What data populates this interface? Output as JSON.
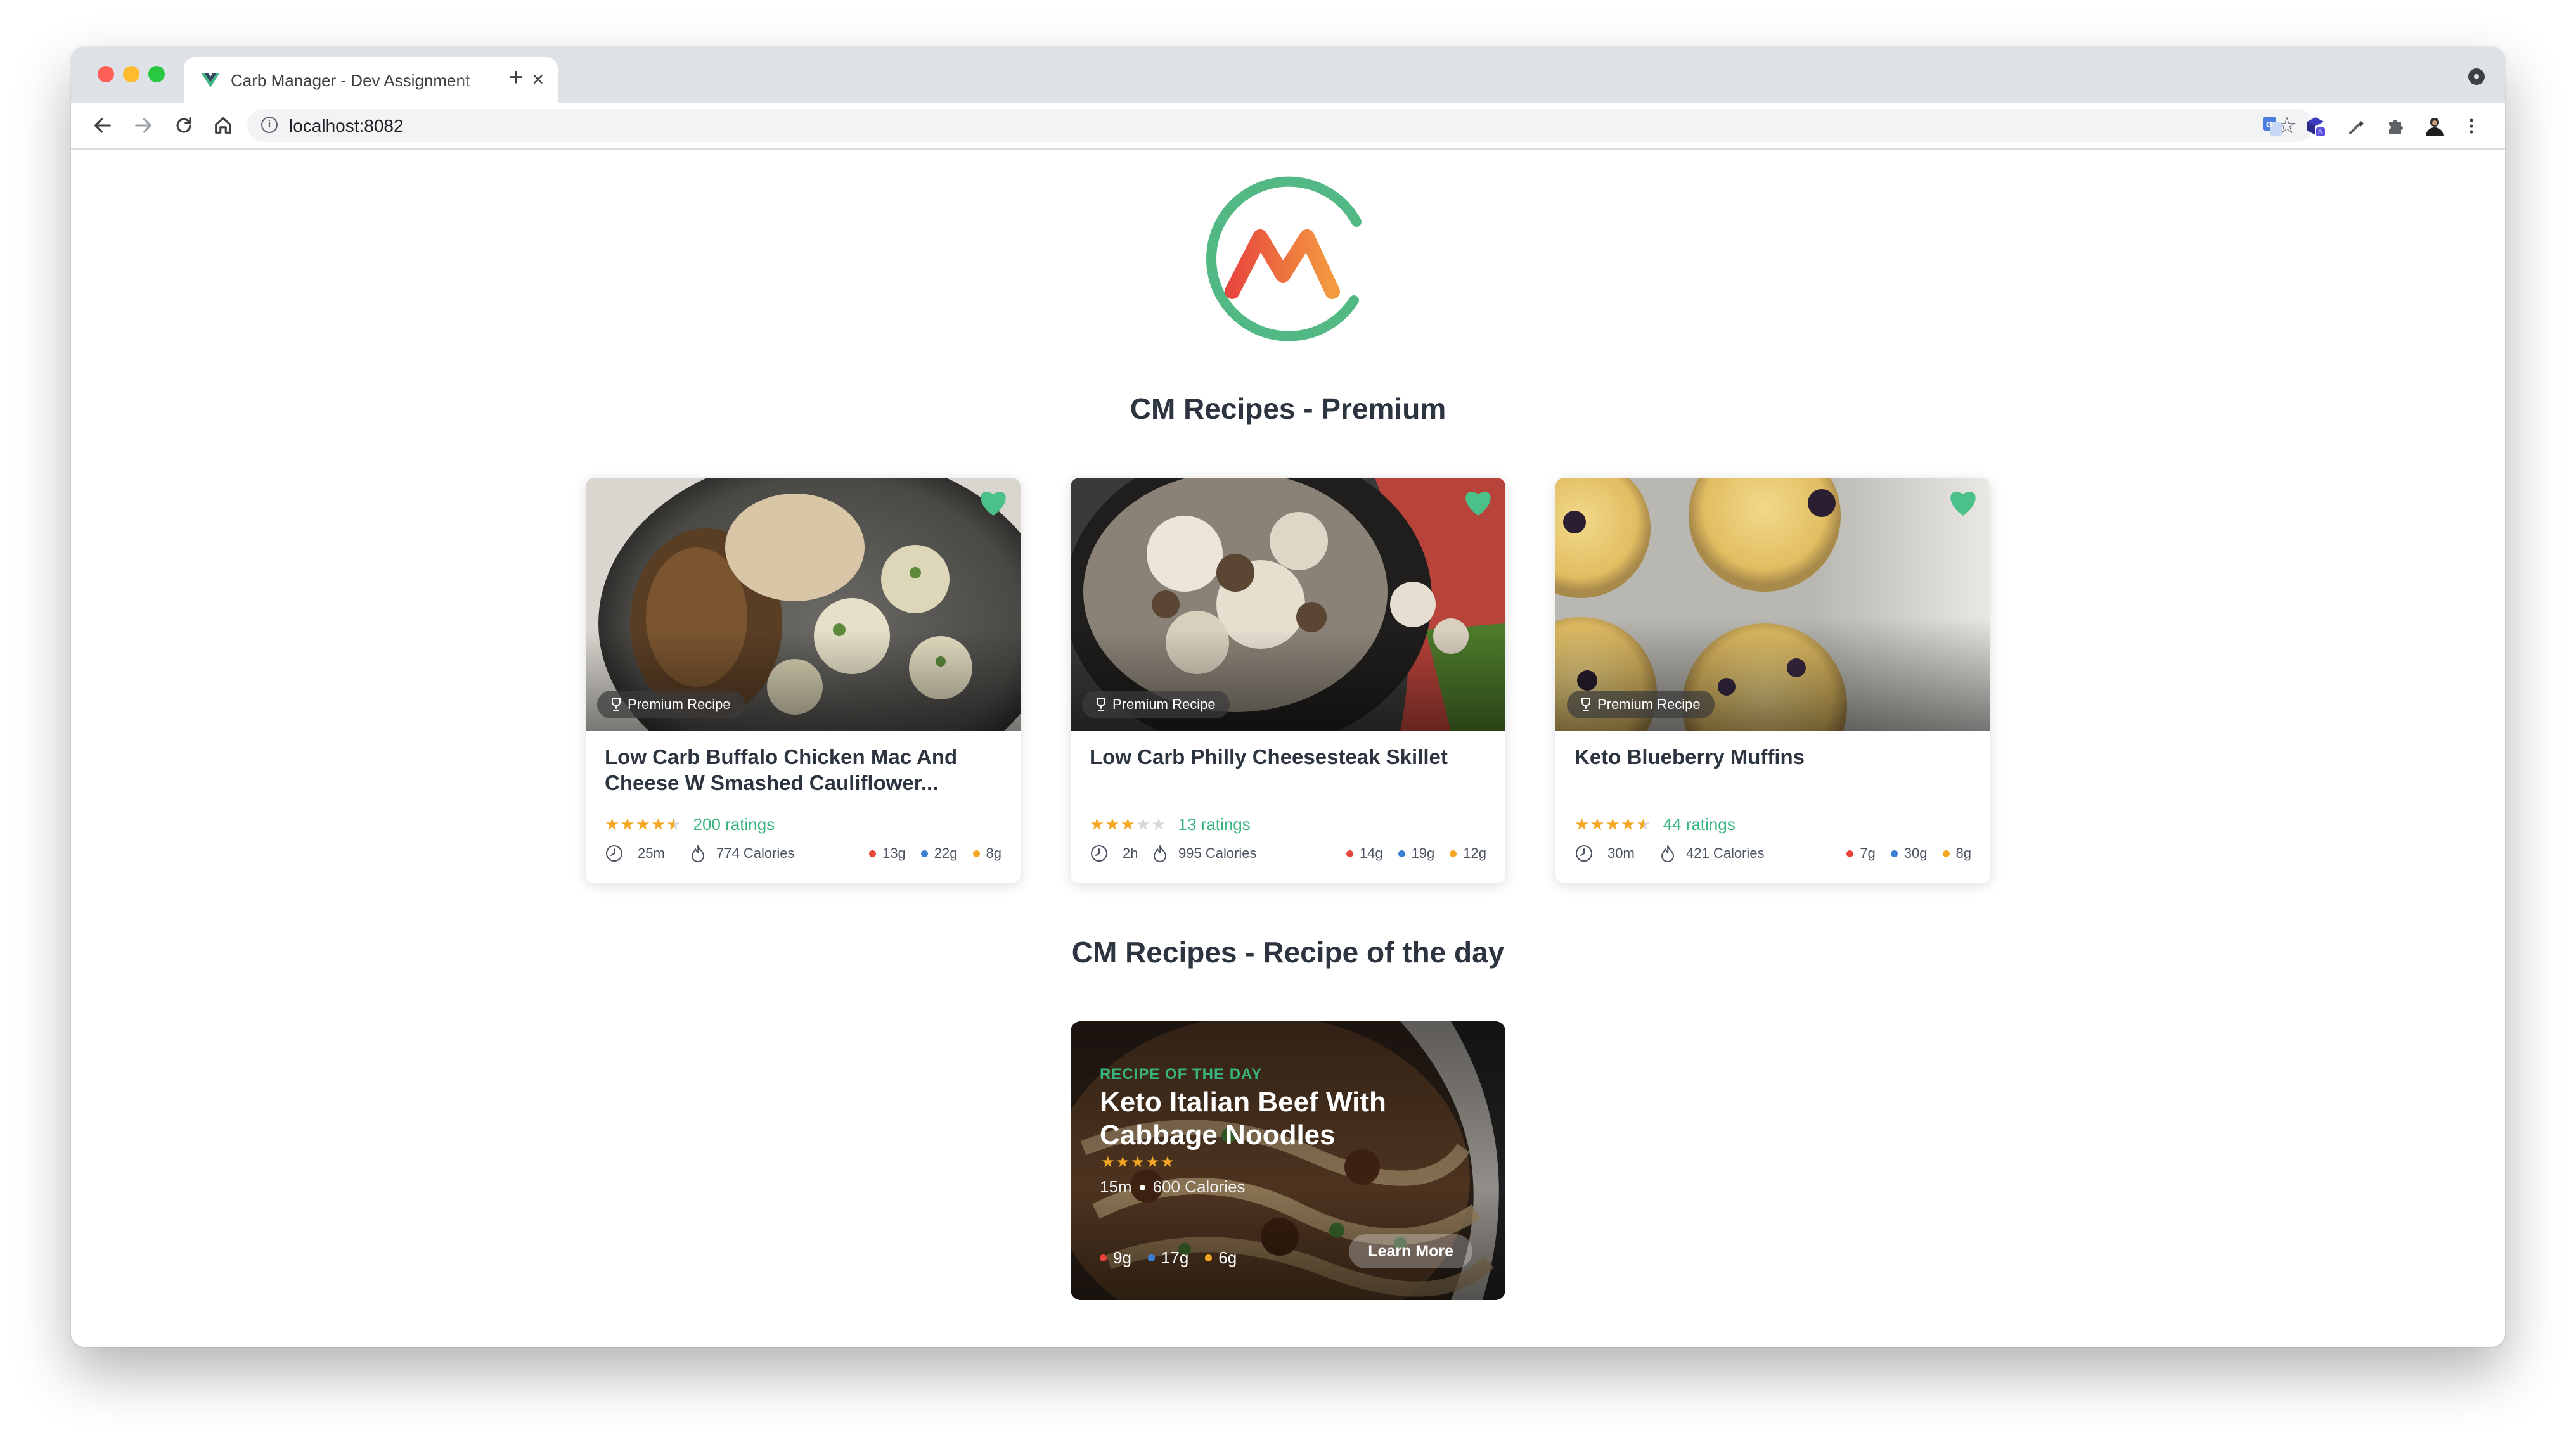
{
  "browser": {
    "tab_title": "Carb Manager - Dev Assignment",
    "url": "localhost:8082"
  },
  "sections": {
    "premium_title": "CM Recipes - Premium",
    "rotd_title": "CM Recipes - Recipe of the day"
  },
  "colors": {
    "brand_green": "#38b47e",
    "star_orange": "#f5a623",
    "carbs_red": "#e8453c",
    "protein_blue": "#3b7fd4",
    "fat_orange": "#f5a623"
  },
  "cards": [
    {
      "badge": "Premium Recipe",
      "title": "Low Carb Buffalo Chicken Mac And Cheese W Smashed Cauliflower...",
      "rating": 4.5,
      "stars": "★★★★★",
      "ratings": "200 ratings",
      "time": "25m",
      "calories": "774 Calories",
      "macros": [
        "13g",
        "22g",
        "8g"
      ],
      "favorited": true
    },
    {
      "badge": "Premium Recipe",
      "title": "Low Carb Philly Cheesesteak Skillet",
      "rating": 3,
      "stars": "★★★★★",
      "ratings": "13 ratings",
      "time": "2h",
      "calories": "995 Calories",
      "macros": [
        "14g",
        "19g",
        "12g"
      ],
      "favorited": true
    },
    {
      "badge": "Premium Recipe",
      "title": "Keto Blueberry Muffins",
      "rating": 4.5,
      "stars": "★★★★★",
      "ratings": "44 ratings",
      "time": "30m",
      "calories": "421 Calories",
      "macros": [
        "7g",
        "30g",
        "8g"
      ],
      "favorited": true
    }
  ],
  "rotd": {
    "kicker": "RECIPE OF THE DAY",
    "title": "Keto Italian Beef With Cabbage Noodles",
    "stars": "★★★★★",
    "time": "15m",
    "calories": "600 Calories",
    "macros": [
      "9g",
      "17g",
      "6g"
    ],
    "button": "Learn More"
  },
  "icons": {
    "back": "arrow-left-icon",
    "forward": "arrow-right-icon",
    "reload": "reload-icon",
    "home": "home-icon",
    "info": "info-icon",
    "bookmark": "star-icon",
    "heart": "heart-icon",
    "trophy": "trophy-icon",
    "clock": "clock-icon",
    "flame": "flame-icon"
  }
}
